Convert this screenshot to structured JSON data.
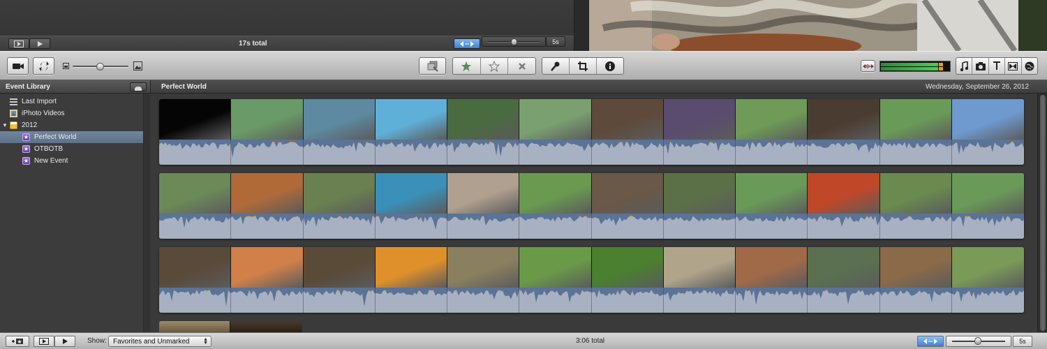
{
  "project": {
    "total_label": "17s total",
    "zoom_label": "5s"
  },
  "toolbar": {
    "icons": [
      "camera-icon",
      "swap-icon",
      "small-thumb-icon",
      "large-thumb-icon",
      "add-to-project-icon",
      "favorite-star-icon",
      "unmark-star-icon",
      "reject-x-icon",
      "voiceover-mic-icon",
      "crop-icon",
      "info-icon",
      "audio-skimming-icon",
      "music-icon",
      "photo-icon",
      "title-icon",
      "transition-icon",
      "map-icon"
    ],
    "thumb_size_level": 0.48
  },
  "sidebar": {
    "title": "Event Library",
    "items": [
      {
        "label": "Last Import",
        "icon": "last-import-icon",
        "indent": false,
        "selected": false
      },
      {
        "label": "iPhoto Videos",
        "icon": "iphoto-icon",
        "indent": false,
        "selected": false
      },
      {
        "label": "2012",
        "icon": "calendar-icon",
        "indent": false,
        "selected": false,
        "disclosure": "▼"
      },
      {
        "label": "Perfect World",
        "icon": "star-event-icon",
        "indent": true,
        "selected": true
      },
      {
        "label": "OTBOTB",
        "icon": "star-event-icon",
        "indent": true,
        "selected": false
      },
      {
        "label": "New Event",
        "icon": "star-event-icon",
        "indent": true,
        "selected": false
      }
    ]
  },
  "browser": {
    "event_title": "Perfect World",
    "event_date": "Wednesday, September 26, 2012"
  },
  "bottom": {
    "show_label": "Show:",
    "filter_value": "Favorites and Unmarked",
    "total_label": "3:06 total",
    "zoom_label": "5s"
  },
  "colors": {
    "accent_selection": "#6a7e96",
    "waveform_blue": "#5a7396",
    "favorite_orange": "#e8a23a",
    "audio_track": "#a7b1c2"
  },
  "strips": [
    {
      "frames": [
        "#050505",
        "#6a9a68",
        "#5d8aa0",
        "#5fb0d8",
        "#4a6a40",
        "#7aa070",
        "#5e4a3a",
        "#5a4c6e",
        "#6f9a58",
        "#4a3c30",
        "#6a9a58",
        "#6e9ad0"
      ]
    },
    {
      "frames": [
        "#6b8a58",
        "#b06a38",
        "#6a8050",
        "#3a90b8",
        "#b0a090",
        "#6a9a50",
        "#6a5848",
        "#5c7048",
        "#6a9a58",
        "#c04828",
        "#6a8a50",
        "#6a9a58"
      ]
    },
    {
      "frames": [
        "#5a4a3a",
        "#d08048",
        "#5a4a38",
        "#e0902a",
        "#8a8060",
        "#6a9a48",
        "#4a8030",
        "#b0a48a",
        "#a06a48",
        "#5a7050",
        "#8a6a48",
        "#7a9a58"
      ]
    }
  ]
}
